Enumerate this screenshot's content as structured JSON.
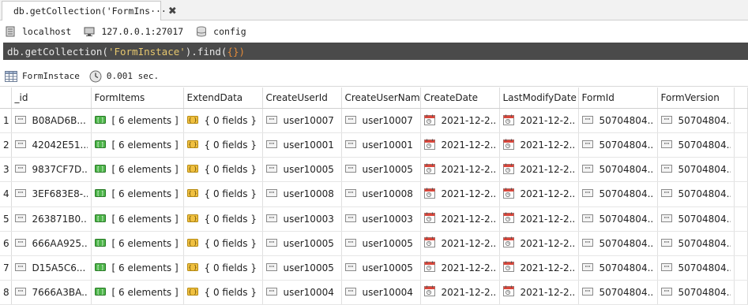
{
  "tab": {
    "title": "db.getCollection('FormIns···",
    "close": "✖"
  },
  "connection": {
    "host": "localhost",
    "address": "127.0.0.1:27017",
    "database": "config"
  },
  "query": {
    "prefix": "db.getCollection(",
    "collection_literal": "'FormInstace'",
    "middle": ").find(",
    "argument": "{}",
    "suffix": ")"
  },
  "result": {
    "collection": "FormInstace",
    "time": "0.001 sec."
  },
  "columns": [
    "_id",
    "FormItems",
    "ExtendData",
    "CreateUserId",
    "CreateUserNam",
    "CreateDate",
    "LastModifyDate",
    "FormId",
    "FormVersion"
  ],
  "rows": [
    {
      "num": "1",
      "id": "B08AD6B...",
      "items": "[ 6 elements ]",
      "extend": "{ 0 fields }",
      "cuid": "user10007",
      "cuname": "user10007",
      "cdate": "2021-12-2...",
      "lmdate": "2021-12-2...",
      "formid": "50704804...",
      "formver": "50704804..."
    },
    {
      "num": "2",
      "id": "42042E51...",
      "items": "[ 6 elements ]",
      "extend": "{ 0 fields }",
      "cuid": "user10001",
      "cuname": "user10001",
      "cdate": "2021-12-2...",
      "lmdate": "2021-12-2...",
      "formid": "50704804...",
      "formver": "50704804..."
    },
    {
      "num": "3",
      "id": "9837CF7D...",
      "items": "[ 6 elements ]",
      "extend": "{ 0 fields }",
      "cuid": "user10005",
      "cuname": "user10005",
      "cdate": "2021-12-2...",
      "lmdate": "2021-12-2...",
      "formid": "50704804...",
      "formver": "50704804..."
    },
    {
      "num": "4",
      "id": "3EF683E8-...",
      "items": "[ 6 elements ]",
      "extend": "{ 0 fields }",
      "cuid": "user10008",
      "cuname": "user10008",
      "cdate": "2021-12-2...",
      "lmdate": "2021-12-2...",
      "formid": "50704804...",
      "formver": "50704804..."
    },
    {
      "num": "5",
      "id": "263871B0...",
      "items": "[ 6 elements ]",
      "extend": "{ 0 fields }",
      "cuid": "user10003",
      "cuname": "user10003",
      "cdate": "2021-12-2...",
      "lmdate": "2021-12-2...",
      "formid": "50704804...",
      "formver": "50704804..."
    },
    {
      "num": "6",
      "id": "666AA925...",
      "items": "[ 6 elements ]",
      "extend": "{ 0 fields }",
      "cuid": "user10005",
      "cuname": "user10005",
      "cdate": "2021-12-2...",
      "lmdate": "2021-12-2...",
      "formid": "50704804...",
      "formver": "50704804..."
    },
    {
      "num": "7",
      "id": "D15A5C6...",
      "items": "[ 6 elements ]",
      "extend": "{ 0 fields }",
      "cuid": "user10005",
      "cuname": "user10005",
      "cdate": "2021-12-2...",
      "lmdate": "2021-12-2...",
      "formid": "50704804...",
      "formver": "50704804..."
    },
    {
      "num": "8",
      "id": "7666A3BA...",
      "items": "[ 6 elements ]",
      "extend": "{ 0 fields }",
      "cuid": "user10004",
      "cuname": "user10004",
      "cdate": "2021-12-2...",
      "lmdate": "2021-12-2...",
      "formid": "50704804...",
      "formver": "50704804..."
    }
  ],
  "icons": {
    "tab": "mongodb-leaf-icon",
    "host": "server-icon",
    "address": "monitor-icon",
    "database": "database-icon",
    "collection": "table-icon",
    "time": "clock-icon",
    "string": "string-type-icon",
    "array": "array-type-icon",
    "object": "object-type-icon",
    "date": "calendar-type-icon"
  },
  "colors": {
    "query_bg": "#4a4a4a",
    "array_icon": "#3aa13a",
    "object_icon": "#e2b12a",
    "date_icon": "#d0453a"
  }
}
